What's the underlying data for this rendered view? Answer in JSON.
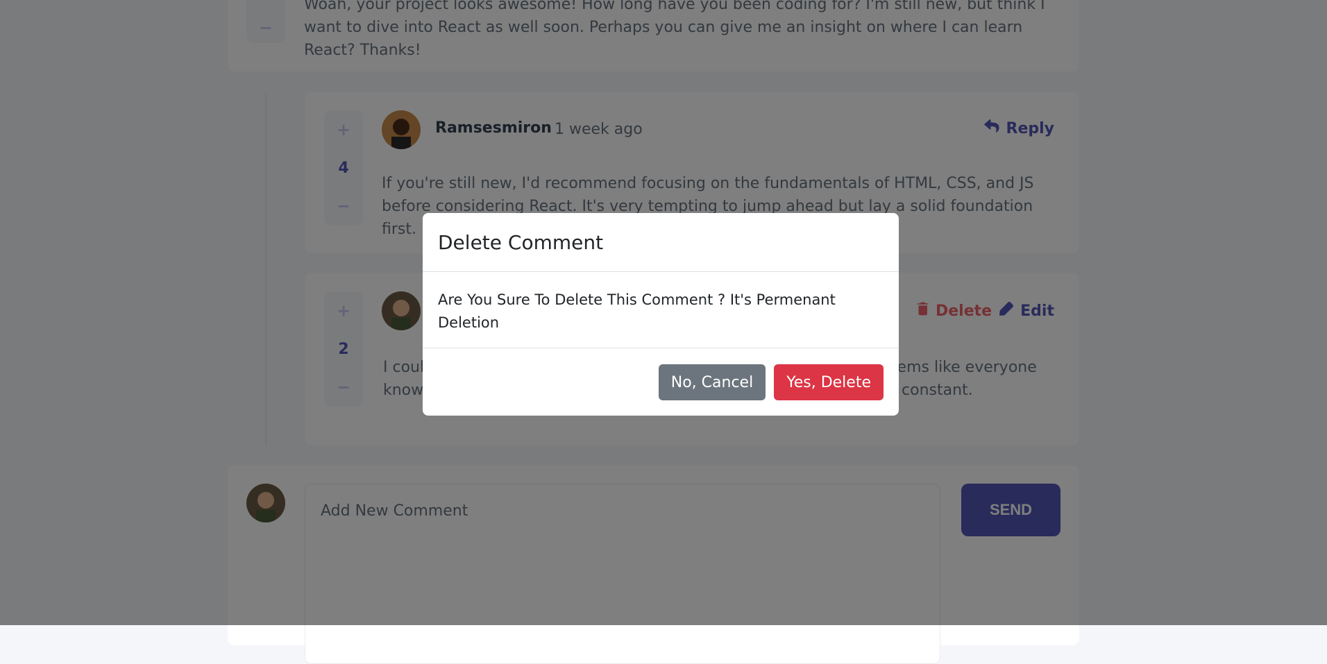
{
  "top_comment": {
    "text": "Woah, your project looks awesome! How long have you been coding for? I'm still new, but think I want to dive into React as well soon. Perhaps you can give me an insight on where I can learn React? Thanks!",
    "minus": "−"
  },
  "reply_1": {
    "username": "Ramsesmiron",
    "time": "1 week ago",
    "reply_label": "Reply",
    "score": "4",
    "plus": "+",
    "minus": "−",
    "text": "If you're still new, I'd recommend focusing on the fundamentals of HTML, CSS, and JS before considering React. It's very tempting to jump ahead but lay a solid foundation first."
  },
  "reply_2": {
    "score": "2",
    "plus": "+",
    "minus": "−",
    "delete_label": "Delete",
    "edit_label": "Edit",
    "text_start": "I coul",
    "text_start_2": "know",
    "text_end": "eems like everyone",
    "text_end_2": "y constant."
  },
  "new_comment": {
    "placeholder": "Add New Comment",
    "send_label": "SEND"
  },
  "modal": {
    "title": "Delete Comment",
    "body": "Are You Sure To Delete This Comment ? It's Permenant Deletion",
    "cancel_label": "No, Cancel",
    "confirm_label": "Yes, Delete"
  },
  "colors": {
    "primary": "#5357b6",
    "danger": "#dc3545",
    "secondary": "#6c757d"
  }
}
